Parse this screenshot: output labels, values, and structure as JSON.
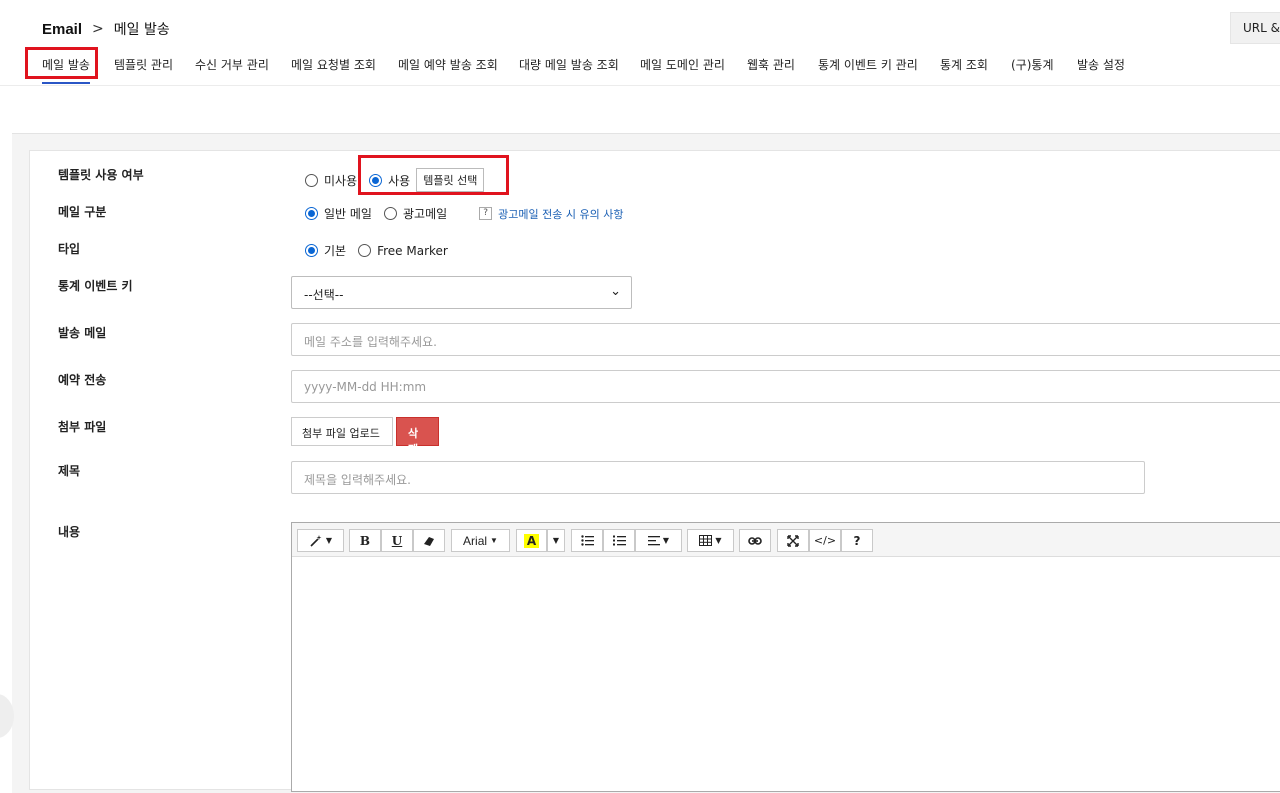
{
  "breadcrumb": {
    "root": "Email",
    "separator": ">",
    "current": "메일 발송"
  },
  "header": {
    "url_button": "URL & A"
  },
  "tabs": [
    {
      "label": "메일 발송",
      "active": true
    },
    {
      "label": "템플릿 관리"
    },
    {
      "label": "수신 거부 관리"
    },
    {
      "label": "메일 요청별 조회"
    },
    {
      "label": "메일 예약 발송 조회"
    },
    {
      "label": "대량 메일 발송 조회"
    },
    {
      "label": "메일 도메인 관리"
    },
    {
      "label": "웹훅 관리"
    },
    {
      "label": "통계 이벤트 키 관리"
    },
    {
      "label": "통계 조회"
    },
    {
      "label": "(구)통계"
    },
    {
      "label": "발송 설정"
    }
  ],
  "form": {
    "template_use": {
      "label": "템플릿 사용 여부",
      "options": [
        "미사용",
        "사용"
      ],
      "selected": "사용",
      "select_button": "템플릿 선택"
    },
    "mail_type": {
      "label": "메일 구분",
      "options": [
        "일반 메일",
        "광고메일"
      ],
      "selected": "일반 메일",
      "help_icon": "?",
      "help_text": "광고메일 전송 시 유의 사항"
    },
    "type": {
      "label": "타입",
      "options": [
        "기본",
        "Free Marker"
      ],
      "selected": "기본"
    },
    "stat_event_key": {
      "label": "통계 이벤트 키",
      "value": "--선택--"
    },
    "sender": {
      "label": "발송 메일",
      "placeholder": "메일 주소를 입력해주세요."
    },
    "reserve": {
      "label": "예약 전송",
      "placeholder": "yyyy-MM-dd HH:mm"
    },
    "attachment": {
      "label": "첨부 파일",
      "upload_button": "첨부 파일 업로드",
      "delete_button": "삭제"
    },
    "subject": {
      "label": "제목",
      "placeholder": "제목을 입력해주세요."
    },
    "content": {
      "label": "내용"
    }
  },
  "editor_toolbar": {
    "magic": "magic-wand-icon",
    "bold": "B",
    "underline": "U",
    "eraser": "eraser-icon",
    "font": "Arial",
    "highlight": "A",
    "ul": "unordered-list-icon",
    "ol": "ordered-list-icon",
    "align": "align-icon",
    "table": "table-icon",
    "link": "link-icon",
    "fullscreen": "fullscreen-icon",
    "code": "</>",
    "help": "?"
  }
}
